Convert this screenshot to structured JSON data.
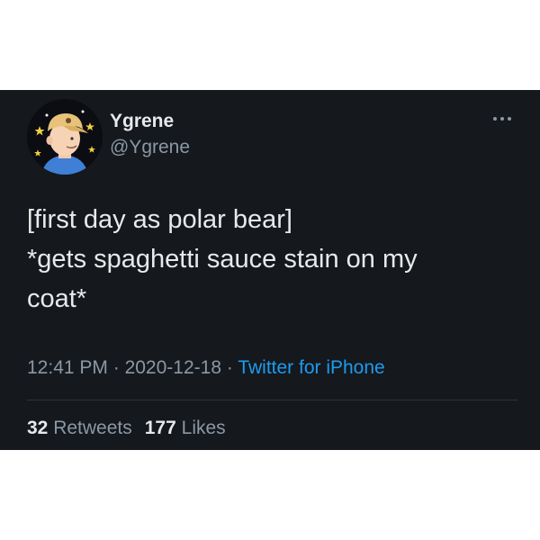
{
  "tweet": {
    "author": {
      "display_name": "Ygrene",
      "handle": "@Ygrene",
      "avatar_icon": "cartoon-avatar-icon"
    },
    "more_icon": "more-options-icon",
    "text_lines": [
      "[first day as polar bear]",
      "*gets spaghetti sauce stain on my",
      "coat*"
    ],
    "time": "12:41 PM",
    "separator": "·",
    "date": "2020-12-18",
    "source": "Twitter for iPhone",
    "retweets_count": "32",
    "retweets_label": "Retweets",
    "likes_count": "177",
    "likes_label": "Likes"
  },
  "colors": {
    "background": "#15181c",
    "text": "#e7e9ea",
    "secondary_text": "#8b98a5",
    "link": "#1d9bf0"
  }
}
